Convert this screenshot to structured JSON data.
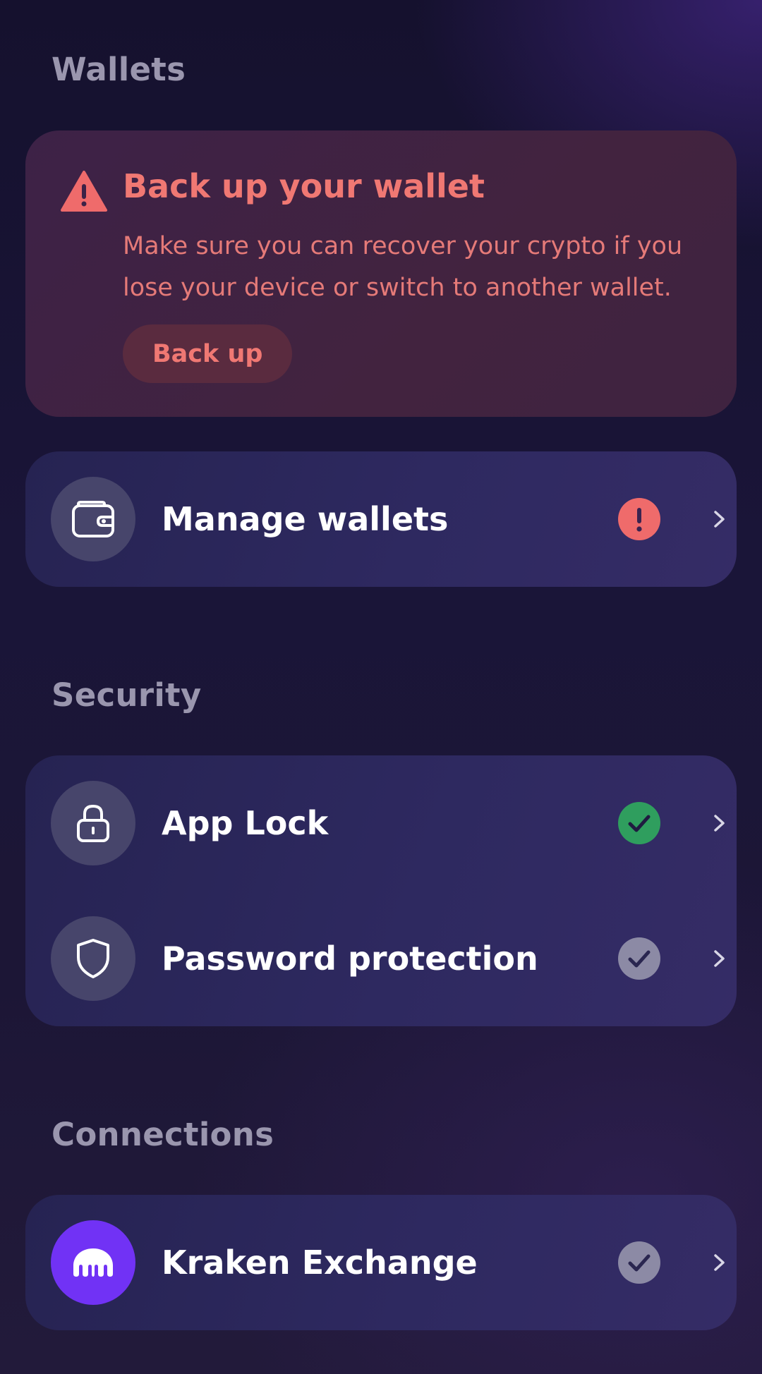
{
  "sections": {
    "wallets": "Wallets",
    "security": "Security",
    "connections": "Connections"
  },
  "backup_card": {
    "title": "Back up your wallet",
    "description": "Make sure you can recover your crypto if you lose your device or switch to another wallet.",
    "button_label": "Back up",
    "icon": "warning-triangle-icon"
  },
  "wallet_items": [
    {
      "label": "Manage wallets",
      "icon": "wallet-icon",
      "status": "alert"
    }
  ],
  "security_items": [
    {
      "label": "App Lock",
      "icon": "lock-icon",
      "status": "enabled"
    },
    {
      "label": "Password protection",
      "icon": "shield-icon",
      "status": "disabled"
    }
  ],
  "connection_items": [
    {
      "label": "Kraken Exchange",
      "icon": "kraken-logo-icon",
      "status": "disabled"
    }
  ],
  "colors": {
    "alert": "#ef6b6b",
    "success": "#2f9e5e",
    "neutral": "#8c8aa5",
    "kraken": "#7132f5",
    "warning_text": "#f07873"
  }
}
